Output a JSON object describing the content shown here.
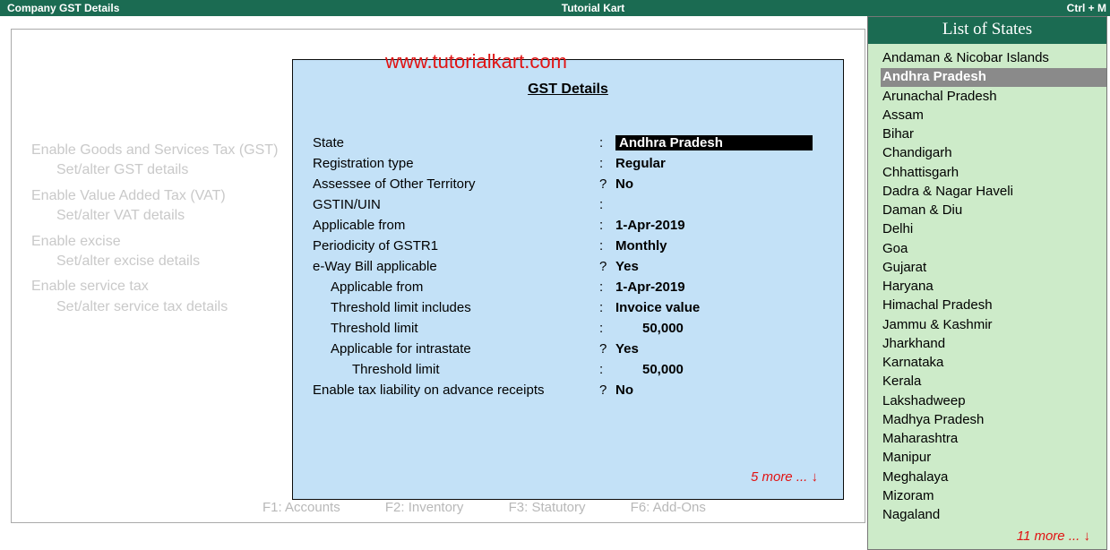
{
  "topbar": {
    "left": "Company GST Details",
    "center": "Tutorial Kart",
    "right": "Ctrl + M"
  },
  "bgHeading": "Tutorial Kart",
  "watermark": "www.tutorialkart.com",
  "bgOptions": {
    "line1": "Enable Goods and Services Tax (GST)",
    "line1sub": "Set/alter GST details",
    "line2": "Enable Value Added Tax (VAT)",
    "line2sub": "Set/alter VAT details",
    "line3": "Enable excise",
    "line3sub": "Set/alter excise details",
    "line4": "Enable service tax",
    "line4sub": "Set/alter service tax details"
  },
  "footer": {
    "f1": "F1: Accounts",
    "f2": "F2: Inventory",
    "f3": "F3: Statutory",
    "f6": "F6: Add-Ons"
  },
  "dialog": {
    "title": "GST Details",
    "fields": {
      "state_lbl": "State",
      "state_val": "Andhra Pradesh",
      "regtype_lbl": "Registration type",
      "regtype_val": "Regular",
      "assessee_lbl": "Assessee of Other Territory",
      "assessee_val": "No",
      "gstin_lbl": "GSTIN/UIN",
      "gstin_val": "",
      "applfrom_lbl": "Applicable from",
      "applfrom_val": "1-Apr-2019",
      "period_lbl": "Periodicity of GSTR1",
      "period_val": "Monthly",
      "eway_lbl": "e-Way Bill applicable",
      "eway_val": "Yes",
      "eway_from_lbl": "Applicable from",
      "eway_from_val": "1-Apr-2019",
      "thresh_incl_lbl": "Threshold limit includes",
      "thresh_incl_val": "Invoice value",
      "thresh_limit_lbl": "Threshold limit",
      "thresh_limit_val": "50,000",
      "intra_lbl": "Applicable for intrastate",
      "intra_val": "Yes",
      "intra_thresh_lbl": "Threshold limit",
      "intra_thresh_val": "50,000",
      "taxliab_lbl": "Enable tax liability on advance receipts",
      "taxliab_val": "No"
    },
    "more": "5 more ... ↓"
  },
  "states": {
    "title": "List of States",
    "items": [
      "Andaman & Nicobar Islands",
      "Andhra Pradesh",
      "Arunachal Pradesh",
      "Assam",
      "Bihar",
      "Chandigarh",
      "Chhattisgarh",
      "Dadra & Nagar Haveli",
      "Daman & Diu",
      "Delhi",
      "Goa",
      "Gujarat",
      "Haryana",
      "Himachal Pradesh",
      "Jammu & Kashmir",
      "Jharkhand",
      "Karnataka",
      "Kerala",
      "Lakshadweep",
      "Madhya Pradesh",
      "Maharashtra",
      "Manipur",
      "Meghalaya",
      "Mizoram",
      "Nagaland"
    ],
    "selectedIndex": 1,
    "more": "11 more ... ↓"
  }
}
